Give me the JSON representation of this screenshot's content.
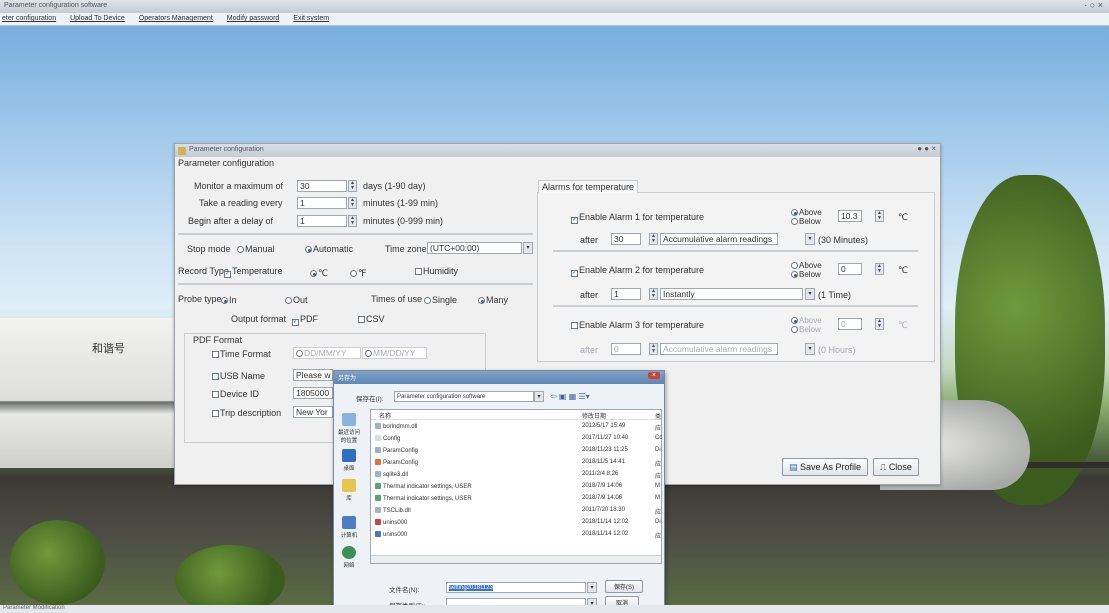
{
  "app": {
    "title": "Parameter configuration software",
    "window_controls": "· ○ ×",
    "status": "Parameter Modification"
  },
  "menu": [
    "eter configuration",
    "Upload To Device",
    "Operators Management",
    "Modify password",
    "Exit system"
  ],
  "scene": {
    "train_text": "和谐号"
  },
  "dialog": {
    "title": "Parameter configuration",
    "controls": "● ● ×",
    "heading": "Parameter configuration",
    "monitor_label": "Monitor a maximum of",
    "monitor_value": "30",
    "monitor_unit": "days (1-90 day)",
    "reading_label": "Take a reading every",
    "reading_value": "1",
    "reading_unit": "minutes (1-99 min)",
    "delay_label": "Begin after a delay of",
    "delay_value": "1",
    "delay_unit": "minutes (0-999 min)",
    "stop_mode_label": "Stop mode",
    "stop_manual": "Manual",
    "stop_auto": "Automatic",
    "timezone_label": "Time zone",
    "timezone_value": "(UTC+00:00)",
    "record_type_label": "Record Type",
    "record_temperature": "Temperature",
    "unit_c": "℃",
    "unit_f": "℉",
    "record_humidity": "Humidity",
    "probe_type_label": "Probe type",
    "probe_in": "In",
    "probe_out": "Out",
    "times_use_label": "Times of use",
    "times_single": "Single",
    "times_many": "Many",
    "output_format_label": "Output format",
    "output_pdf": "PDF",
    "output_csv": "CSV",
    "pdf_format_label": "PDF Format",
    "time_format_label": "Time Format",
    "time_format_opt1": "DD/MM/YY",
    "time_format_opt2": "MM/DD/YY",
    "usb_name_label": "USB Name",
    "usb_name_value": "Please w",
    "device_id_label": "Device ID",
    "device_id_value": "1805000",
    "trip_desc_label": "Trip description",
    "trip_desc_value": "New Yor",
    "alarms_tab": "Alarms for temperature",
    "alarm1_label": "Enable Alarm 1 for temperature",
    "alarm2_label": "Enable Alarm 2 for temperature",
    "alarm3_label": "Enable Alarm 3 for temperature",
    "above": "Above",
    "below": "Below",
    "alarm1_temp": "10.3",
    "alarm2_temp": "0",
    "alarm3_temp": "0",
    "temp_unit": "℃",
    "after_label": "after",
    "alarm1_after": "30",
    "alarm1_mode": "Accumulative alarm readings",
    "alarm1_time": "(30 Minutes)",
    "alarm2_after": "1",
    "alarm2_mode": "Instantly",
    "alarm2_time": "(1 Time)",
    "alarm3_after": "0",
    "alarm3_mode": "Accumulative alarm readings",
    "alarm3_time": "(0 Hours)",
    "save_profile": "Save As Profile",
    "close": "Close"
  },
  "file_dialog": {
    "title": "另存为",
    "save_in_label": "保存在(I):",
    "save_in_value": "Parameter configuration software",
    "col_name": "名称",
    "col_date": "修改日期",
    "col_type": "类",
    "places": [
      "最近访问的位置",
      "桌面",
      "库",
      "计算机",
      "网络"
    ],
    "files": [
      {
        "name": "borlndmm.dll",
        "date": "2012/5/17 15:49",
        "type": "应"
      },
      {
        "name": "Config",
        "date": "2017/11/27 10:40",
        "type": "Cc"
      },
      {
        "name": "ParamConfig",
        "date": "2018/11/23 11:25",
        "type": "Di"
      },
      {
        "name": "ParamConfig",
        "date": "2018/11/5 14:41",
        "type": "应"
      },
      {
        "name": "sqlite3.dll",
        "date": "2011/2/4 8:26",
        "type": "应"
      },
      {
        "name": "Thermal indicator settings, USER",
        "date": "2018/7/9 14:06",
        "type": "M"
      },
      {
        "name": "Thermal indicator settings, USER",
        "date": "2018/7/9 14:06",
        "type": "M"
      },
      {
        "name": "TSCLib.dll",
        "date": "2011/7/20 18:30",
        "type": "应"
      },
      {
        "name": "unins000",
        "date": "2018/11/14 12:02",
        "type": "Di"
      },
      {
        "name": "unins000",
        "date": "2018/11/14 12:02",
        "type": "应"
      }
    ],
    "filename_label": "文件名(N):",
    "filename_value": "setting20181123",
    "filetype_label": "保存类型(T):",
    "save_button": "保存(S)",
    "cancel_button": "取消"
  }
}
